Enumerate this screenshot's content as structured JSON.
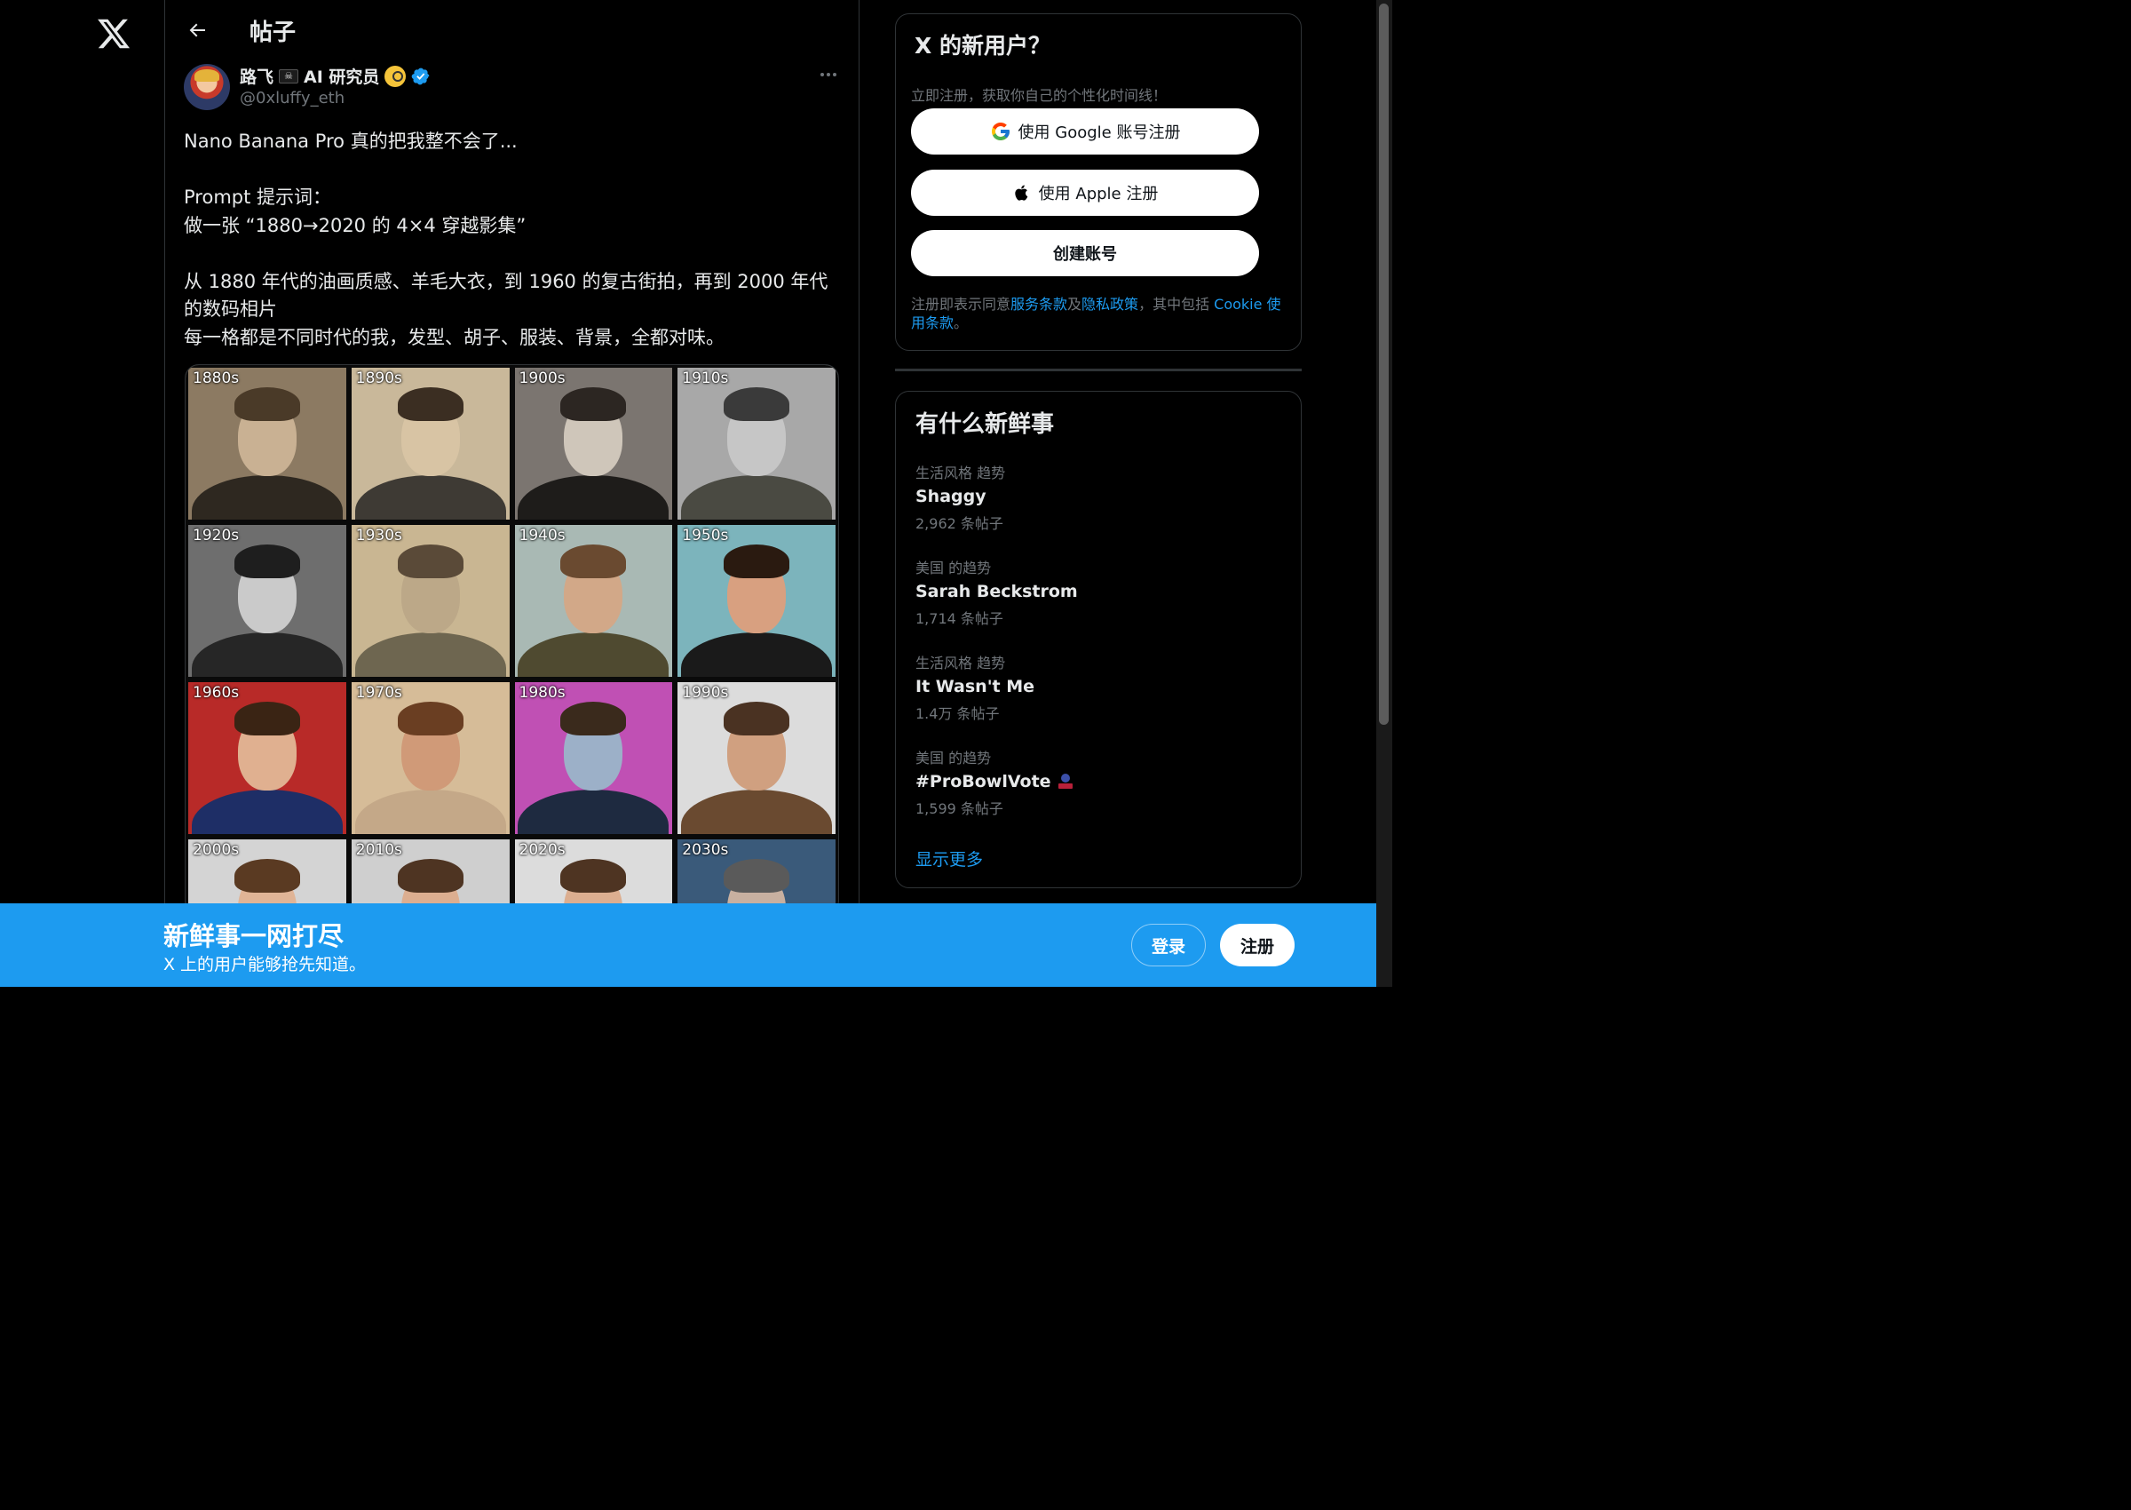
{
  "nav": {
    "logo": "x-logo-icon"
  },
  "topbar": {
    "title": "帖子",
    "back_icon": "arrow-left-icon"
  },
  "post": {
    "author_name": "路飞",
    "author_name_suffix": "AI 研究员",
    "handle": "@0xluffy_eth",
    "text": "Nano Banana Pro 真的把我整不会了...\n\nPrompt 提示词：\n做一张 “1880→2020 的 4×4 穿越影集”\n\n从 1880 年代的油画质感、羊毛大衣，到 1960 的复古街拍，再到 2000 年代的数码相片\n每一格都是不同时代的我，发型、胡子、服装、背景，全都对味。",
    "photos": [
      {
        "label": "1880s",
        "bg": "#8c7a62",
        "tone": "#c9b193",
        "hair": "#4a3a28",
        "body": "#2e2820"
      },
      {
        "label": "1890s",
        "bg": "#c9b89a",
        "tone": "#d8c4a4",
        "hair": "#3b2e22",
        "body": "#3e3a34"
      },
      {
        "label": "1900s",
        "bg": "#7b7570",
        "tone": "#cfc6ba",
        "hair": "#2c2622",
        "body": "#1e1c1a"
      },
      {
        "label": "1910s",
        "bg": "#a8a8a8",
        "tone": "#c6c6c6",
        "hair": "#3a3a3a",
        "body": "#4a4a42"
      },
      {
        "label": "1920s",
        "bg": "#6e6e6e",
        "tone": "#cacaca",
        "hair": "#1e1e1e",
        "body": "#262626"
      },
      {
        "label": "1930s",
        "bg": "#c9b692",
        "tone": "#bca888",
        "hair": "#5a4a38",
        "body": "#6e6650"
      },
      {
        "label": "1940s",
        "bg": "#a9b9b4",
        "tone": "#d2a888",
        "hair": "#6a4a30",
        "body": "#4f4a30"
      },
      {
        "label": "1950s",
        "bg": "#7cb4bc",
        "tone": "#d8a080",
        "hair": "#2a1a10",
        "body": "#1a1a1a"
      },
      {
        "label": "1960s",
        "bg": "#b82a28",
        "tone": "#e0b090",
        "hair": "#3a2414",
        "body": "#1e2e66"
      },
      {
        "label": "1970s",
        "bg": "#d6bc98",
        "tone": "#d09a78",
        "hair": "#6a3e22",
        "body": "#c4a888"
      },
      {
        "label": "1980s",
        "bg": "#c050b4",
        "tone": "#9cb0c8",
        "hair": "#3a2a1c",
        "body": "#1e2a40"
      },
      {
        "label": "1990s",
        "bg": "#dcdcdc",
        "tone": "#d0a080",
        "hair": "#4a3222",
        "body": "#6a4a30"
      },
      {
        "label": "2000s",
        "bg": "#d4d4d4",
        "tone": "#e0b496",
        "hair": "#5a3a22",
        "body": "#333333"
      },
      {
        "label": "2010s",
        "bg": "#cfcfcf",
        "tone": "#dcae90",
        "hair": "#4e3422",
        "body": "#333333"
      },
      {
        "label": "2020s",
        "bg": "#dcdcdc",
        "tone": "#dcae90",
        "hair": "#4e3422",
        "body": "#333333"
      },
      {
        "label": "2030s",
        "bg": "#3a5a7a",
        "tone": "#c8b0a0",
        "hair": "#5a5a5a",
        "body": "#2a3a4a"
      }
    ]
  },
  "signup": {
    "title": "X 的新用户？",
    "subtitle": "立即注册，获取你自己的个性化时间线！",
    "google_label": "使用 Google 账号注册",
    "apple_label": "使用 Apple 注册",
    "create_label": "创建账号",
    "terms_prefix": "注册即表示同意",
    "terms_link": "服务条款",
    "terms_and": "及",
    "privacy_link": "隐私政策",
    "terms_mid": "，其中包括 ",
    "cookie_link": "Cookie 使用条款",
    "terms_end": "。"
  },
  "trends": {
    "title": "有什么新鲜事",
    "items": [
      {
        "context": "生活风格 趋势",
        "name": "Shaggy",
        "count": "2,962 条帖子"
      },
      {
        "context": "美国 的趋势",
        "name": "Sarah Beckstrom",
        "count": "1,714 条帖子"
      },
      {
        "context": "生活风格 趋势",
        "name": "It Wasn't Me",
        "count": "1.4万 条帖子"
      },
      {
        "context": "美国 的趋势",
        "name": "#ProBowlVote",
        "count": "1,599 条帖子"
      }
    ],
    "show_more": "显示更多"
  },
  "banner": {
    "title": "新鲜事一网打尽",
    "subtitle": "X 上的用户能够抢先知道。",
    "login_label": "登录",
    "register_label": "注册"
  },
  "colors": {
    "accent": "#1d9bf0",
    "background": "#000000",
    "border": "#2f3336",
    "muted": "#71767b"
  }
}
